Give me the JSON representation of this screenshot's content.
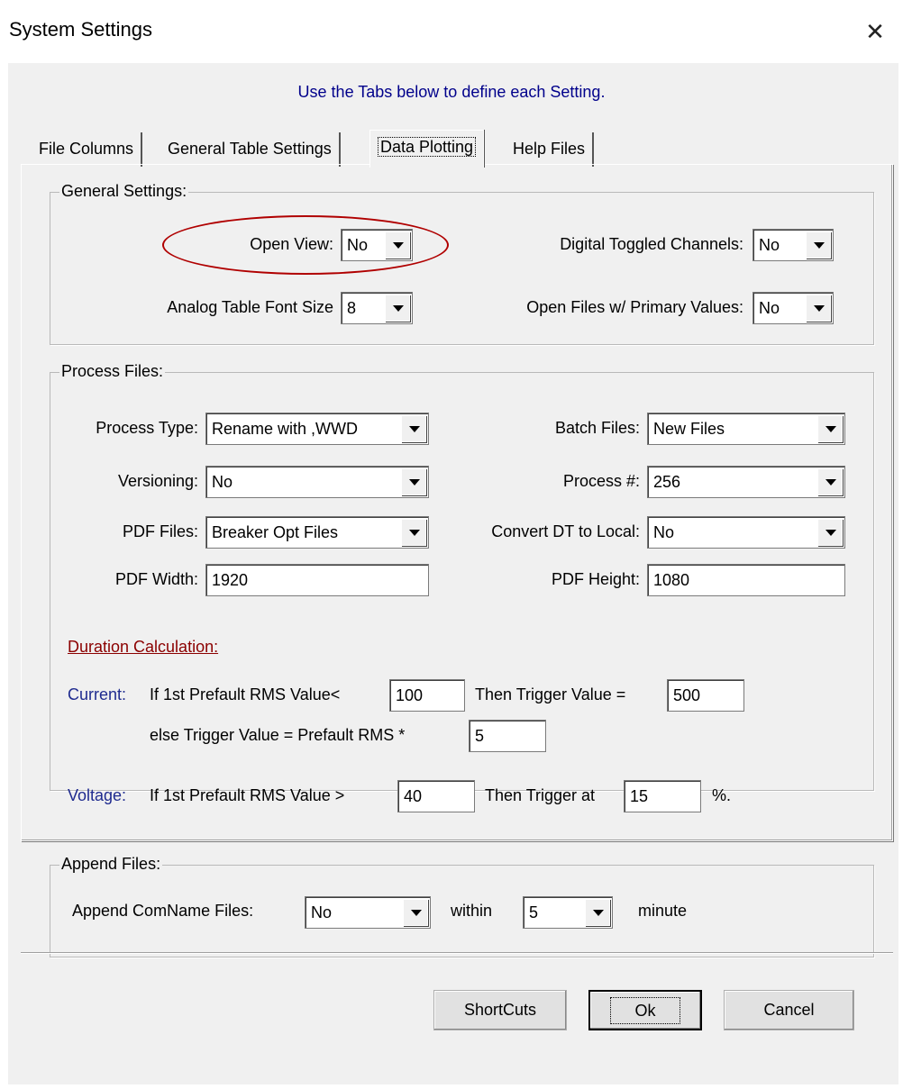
{
  "window": {
    "title": "System Settings",
    "close_glyph": "✕"
  },
  "instruction": "Use the Tabs below to define each Setting.",
  "tabs": [
    {
      "label": "File Columns",
      "active": false
    },
    {
      "label": "General Table Settings",
      "active": false
    },
    {
      "label": "Data Plotting",
      "active": true
    },
    {
      "label": "Help Files",
      "active": false
    }
  ],
  "general": {
    "title": "General Settings:",
    "open_view_label": "Open View:",
    "open_view_value": "No",
    "digital_toggled_label": "Digital Toggled Channels:",
    "digital_toggled_value": "No",
    "analog_font_label": "Analog Table Font Size",
    "analog_font_value": "8",
    "open_primary_label": "Open Files w/ Primary Values:",
    "open_primary_value": "No"
  },
  "process": {
    "title": "Process Files:",
    "process_type_label": "Process Type:",
    "process_type_value": "Rename with ,WWD",
    "batch_files_label": "Batch Files:",
    "batch_files_value": "New Files",
    "versioning_label": "Versioning:",
    "versioning_value": "No",
    "process_num_label": "Process #:",
    "process_num_value": "256",
    "pdf_files_label": "PDF Files:",
    "pdf_files_value": "Breaker Opt Files",
    "convert_dt_label": "Convert DT to Local:",
    "convert_dt_value": "No",
    "pdf_width_label": "PDF Width:",
    "pdf_width_value": "1920",
    "pdf_height_label": "PDF Height:",
    "pdf_height_value": "1080",
    "duration_heading": "Duration Calculation:",
    "current_label": "Current:",
    "current_if_text": "If 1st Prefault RMS Value<",
    "current_if_value": "100",
    "current_then_text": "Then Trigger Value =",
    "current_then_value": "500",
    "current_else_text": "else Trigger Value =  Prefault RMS *",
    "current_else_value": "5",
    "voltage_label": "Voltage:",
    "voltage_if_text": "If 1st Prefault RMS Value >",
    "voltage_if_value": "40",
    "voltage_then_text": "Then Trigger at",
    "voltage_then_value": "15",
    "voltage_unit": "%."
  },
  "append": {
    "title": "Append Files:",
    "comname_label": "Append ComName Files:",
    "comname_value": "No",
    "within_label": "within",
    "within_value": "5",
    "unit_label": "minute"
  },
  "buttons": {
    "shortcuts": "ShortCuts",
    "ok": "Ok",
    "cancel": "Cancel"
  },
  "annotation_color": "#b00000"
}
